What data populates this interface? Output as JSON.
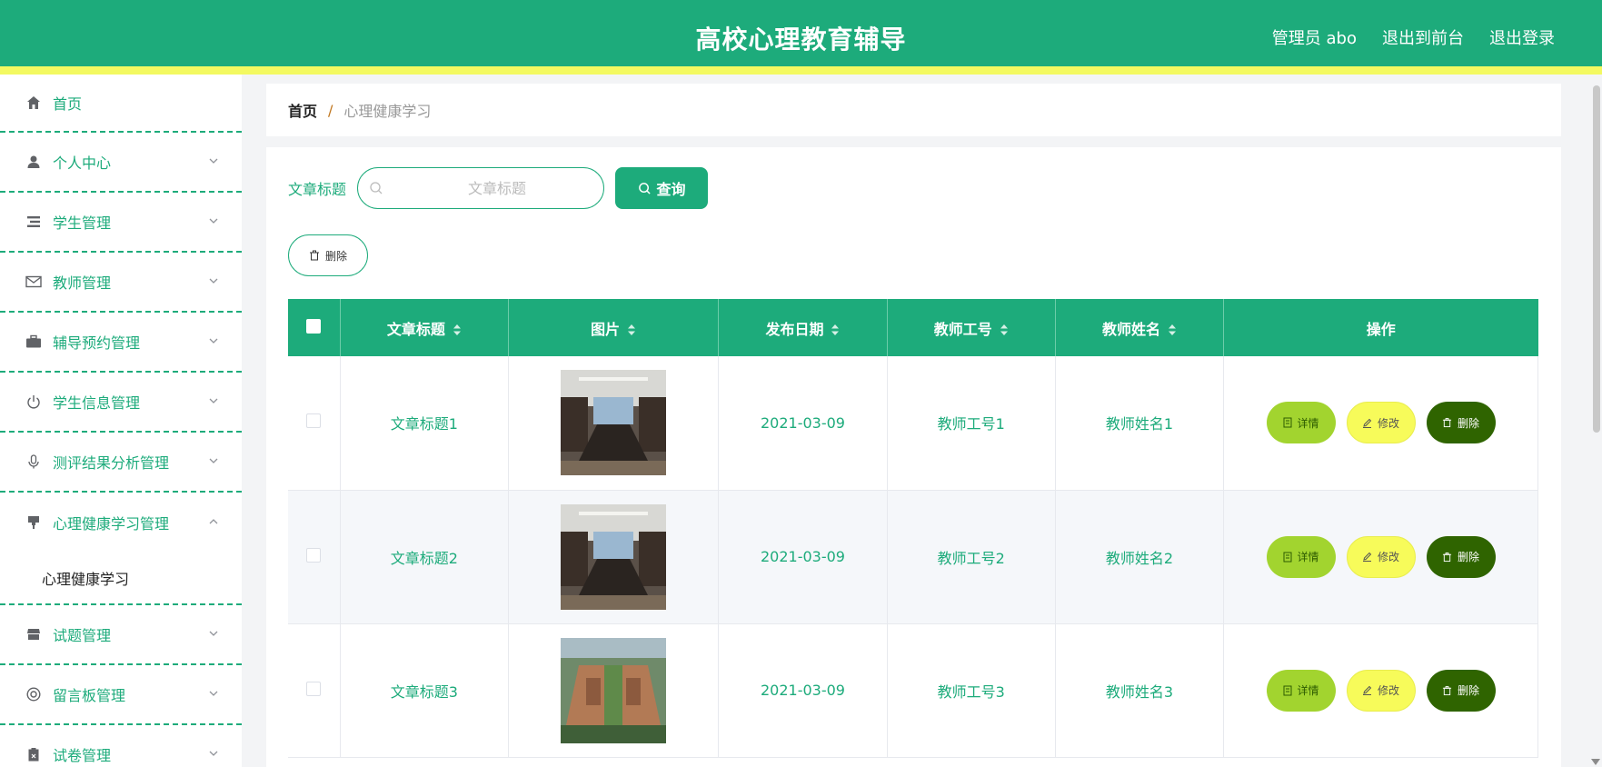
{
  "header": {
    "title": "高校心理教育辅导",
    "user_label": "管理员 abo",
    "exit_front": "退出到前台",
    "logout": "退出登录"
  },
  "sidebar": {
    "items": [
      {
        "label": "首页",
        "icon": "home-icon"
      },
      {
        "label": "个人中心",
        "icon": "user-icon"
      },
      {
        "label": "学生管理",
        "icon": "list-icon"
      },
      {
        "label": "教师管理",
        "icon": "mail-icon"
      },
      {
        "label": "辅导预约管理",
        "icon": "briefcase-icon"
      },
      {
        "label": "学生信息管理",
        "icon": "power-icon"
      },
      {
        "label": "测评结果分析管理",
        "icon": "microphone-icon"
      },
      {
        "label": "心理健康学习管理",
        "icon": "brush-icon"
      },
      {
        "label": "试题管理",
        "icon": "shop-icon"
      },
      {
        "label": "留言板管理",
        "icon": "lifebuoy-icon"
      },
      {
        "label": "试卷管理",
        "icon": "clipboard-icon"
      }
    ],
    "submenu_label": "心理健康学习"
  },
  "breadcrumb": {
    "home": "首页",
    "separator": "/",
    "current": "心理健康学习"
  },
  "search": {
    "label": "文章标题",
    "placeholder": "文章标题",
    "value": "",
    "button": "查询"
  },
  "toolbar": {
    "delete_label": "删除"
  },
  "table": {
    "columns": [
      "文章标题",
      "图片",
      "发布日期",
      "教师工号",
      "教师姓名",
      "操作"
    ],
    "rows": [
      {
        "title": "文章标题1",
        "image": "meeting-room-photo",
        "date": "2021-03-09",
        "teacher_id": "教师工号1",
        "teacher_name": "教师姓名1"
      },
      {
        "title": "文章标题2",
        "image": "meeting-room-photo",
        "date": "2021-03-09",
        "teacher_id": "教师工号2",
        "teacher_name": "教师姓名2"
      },
      {
        "title": "文章标题3",
        "image": "campus-aerial-photo",
        "date": "2021-03-09",
        "teacher_id": "教师工号3",
        "teacher_name": "教师姓名3"
      }
    ],
    "actions": {
      "detail": "详情",
      "edit": "修改",
      "delete": "删除"
    }
  },
  "colors": {
    "primary": "#1dab7b",
    "accent_yellow": "#f3f961",
    "detail_btn": "#a2d42f",
    "edit_btn": "#f7fb5a",
    "delete_btn": "#2f6400"
  }
}
